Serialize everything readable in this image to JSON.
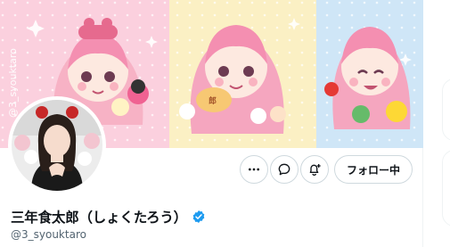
{
  "profile": {
    "display_name": "三年食太郎（しょくたろう）",
    "handle": "@3_syouktaro",
    "verified": true,
    "banner_watermark": "@3_syouktaro",
    "bowl_mark": "郎"
  },
  "actions": {
    "more_icon": "more-horizontal-icon",
    "message_icon": "message-bubble-icon",
    "subscribe_icon": "notification-bell-plus-icon",
    "follow_label": "フォロー中"
  },
  "colors": {
    "verified_blue": "#1d9bf0",
    "banner_pink": "#fbd0de",
    "banner_yellow": "#fbf0c4",
    "banner_blue": "#cfe6f7",
    "handle_gray": "#536471",
    "border_gray": "#cfd9de"
  }
}
